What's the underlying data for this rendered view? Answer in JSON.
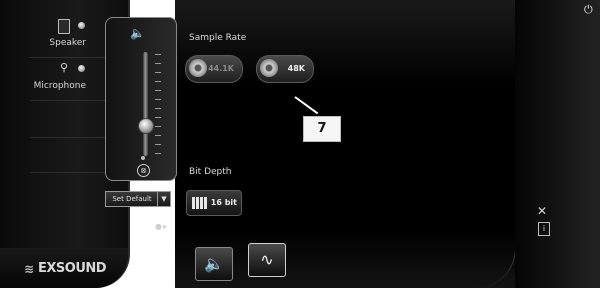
{
  "sidebar": {
    "devices": [
      {
        "label": "Speaker",
        "icon": "speaker-device-icon"
      },
      {
        "label": "Microphone",
        "icon": "microphone-device-icon"
      }
    ],
    "set_default_label": "Set Default",
    "logo_text": "EXSOUND"
  },
  "volume": {
    "speaker_icon": "🔈",
    "mute_icon": "⊗",
    "level": 0.3
  },
  "main": {
    "sample_rate_label": "Sample Rate",
    "sample_rates": [
      {
        "label": "44.1K",
        "selected": false
      },
      {
        "label": "48K",
        "selected": true
      }
    ],
    "bit_depth_label": "Bit Depth",
    "bit_depth_value": "16 bit",
    "callout_number": "7"
  },
  "bottom_buttons": [
    {
      "glyph": "🔈",
      "name": "speaker-settings"
    },
    {
      "glyph": "∿",
      "name": "waveform"
    }
  ],
  "right": {
    "power_glyph": "⏻",
    "tools_glyph": "✕",
    "info_glyph": "i"
  },
  "colors": {
    "background": "#000000",
    "accent": "#ffffff",
    "text": "#dcdcdc"
  }
}
